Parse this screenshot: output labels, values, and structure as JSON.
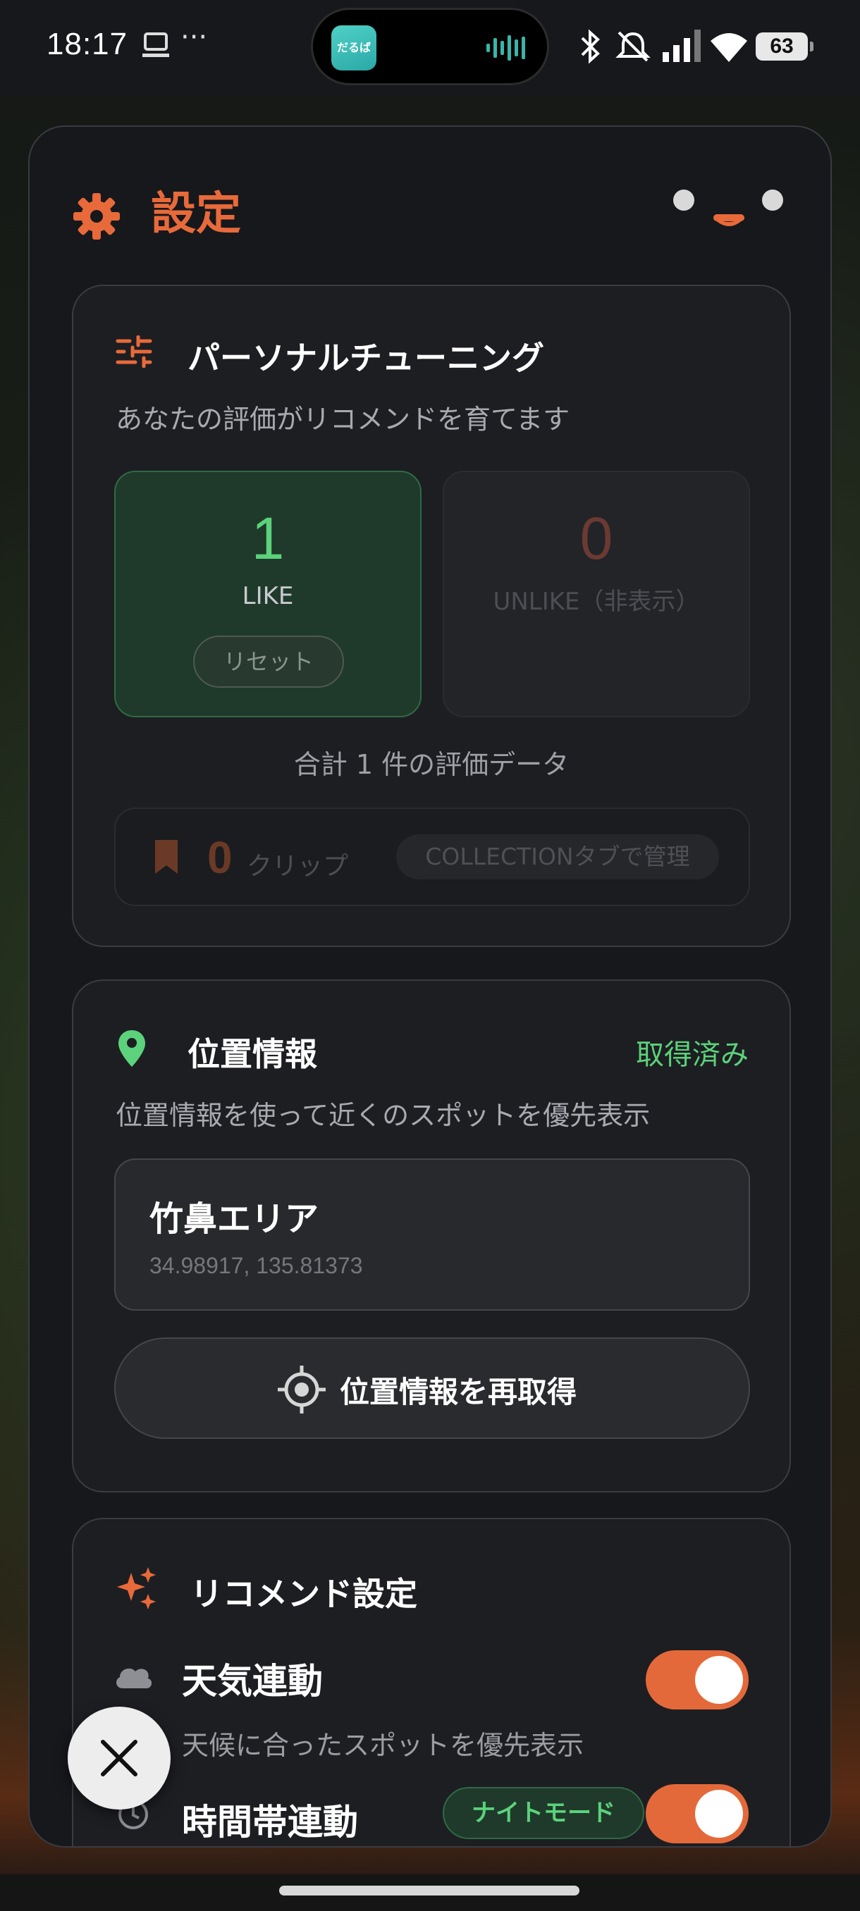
{
  "status_bar": {
    "time": "18:17",
    "more": "···",
    "battery": "63",
    "island_app_label": "だるば"
  },
  "settings": {
    "title": "設定",
    "icons": {
      "title": "gear-icon",
      "close": "close-icon"
    }
  },
  "tuning": {
    "title": "パーソナルチューニング",
    "subtitle": "あなたの評価がリコメンドを育てます",
    "like": {
      "count": "1",
      "label": "LIKE",
      "reset": "リセット"
    },
    "unlike": {
      "count": "0",
      "label": "UNLIKE（非表示）"
    },
    "total": "合計 1 件の評価データ",
    "clip": {
      "count": "0",
      "label": "クリップ",
      "pill": "COLLECTIONタブで管理"
    },
    "colors": {
      "like": "#5bd27b",
      "unlike": "#6b3a32",
      "accent": "#e86a3a"
    }
  },
  "location": {
    "title": "位置情報",
    "status": "取得済み",
    "subtitle": "位置情報を使って近くのスポットを優先表示",
    "area_name": "竹鼻エリア",
    "coords": "34.98917, 135.81373",
    "refetch": "位置情報を再取得"
  },
  "recommend": {
    "title": "リコメンド設定",
    "weather": {
      "title": "天気連動",
      "subtitle": "天候に合ったスポットを優先表示",
      "enabled": true
    },
    "time": {
      "title": "時間帯連動",
      "badge": "ナイトモード",
      "enabled": true
    }
  }
}
